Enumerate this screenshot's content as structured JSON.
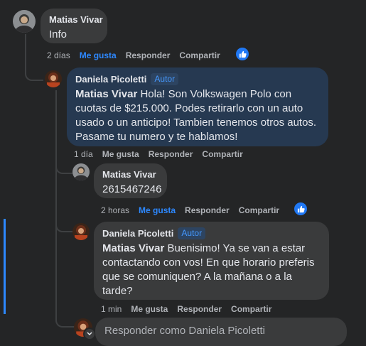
{
  "comments": [
    {
      "author": "Matias Vivar",
      "text": "Info",
      "age": "2 días",
      "like": "Me gusta",
      "reply": "Responder",
      "share": "Compartir"
    },
    {
      "author": "Daniela Picoletti",
      "badge": "Autor",
      "mention": "Matias Vivar",
      "text": " Hola! Son Volkswagen Polo con cuotas de $215.000. Podes retirarlo con un auto usado o un anticipo! Tambien tenemos otros autos. Pasame tu numero y te hablamos!",
      "age": "1 día",
      "like": "Me gusta",
      "reply": "Responder",
      "share": "Compartir"
    },
    {
      "author": "Matias Vivar",
      "text": "2615467246",
      "age": "2 horas",
      "like": "Me gusta",
      "reply": "Responder",
      "share": "Compartir"
    },
    {
      "author": "Daniela Picoletti",
      "badge": "Autor",
      "mention": "Matias Vivar",
      "text": " Buenisimo! Ya se van a estar contactando con vos! En que horario preferis que se comuniquen? A la mañana o a la tarde?",
      "age": "1 min",
      "like": "Me gusta",
      "reply": "Responder",
      "share": "Compartir"
    }
  ],
  "reply_box": {
    "placeholder": "Responder como Daniela Picoletti"
  },
  "colors": {
    "background": "#242526",
    "bubble": "#3a3b3c",
    "author_bubble": "#263951",
    "accent": "#2d88ff"
  }
}
